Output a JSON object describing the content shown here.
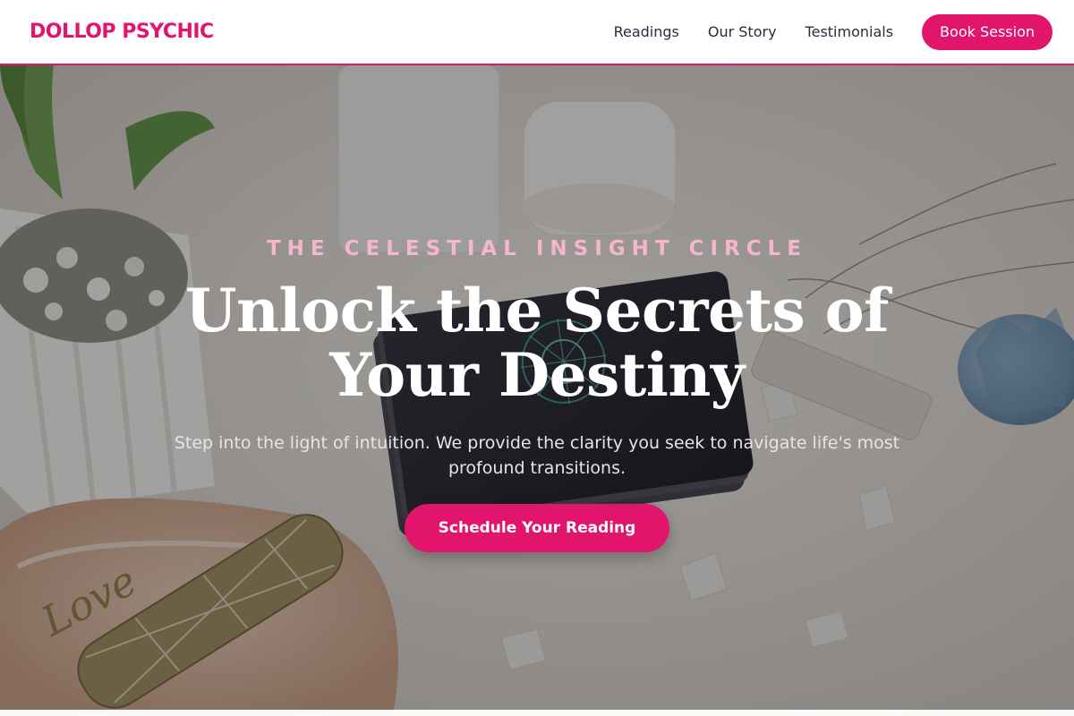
{
  "header": {
    "logo": "DOLLOP PSYCHIC",
    "nav": [
      "Readings",
      "Our Story",
      "Testimonials"
    ],
    "cta": "Book Session"
  },
  "hero": {
    "eyebrow": "THE CELESTIAL INSIGHT CIRCLE",
    "headline": "Unlock the Secrets of Your Destiny",
    "subtext": "Step into the light of intuition. We provide the clarity you seek to navigate life's most profound transitions.",
    "cta": "Schedule Your Reading",
    "background_decal": "Love"
  },
  "colors": {
    "accent": "#e0156b",
    "eyebrow": "#f4b6cc"
  },
  "icons": [
    "succulent-plant-image",
    "tarot-deck-image",
    "crystal-image",
    "sage-bundle-image"
  ]
}
